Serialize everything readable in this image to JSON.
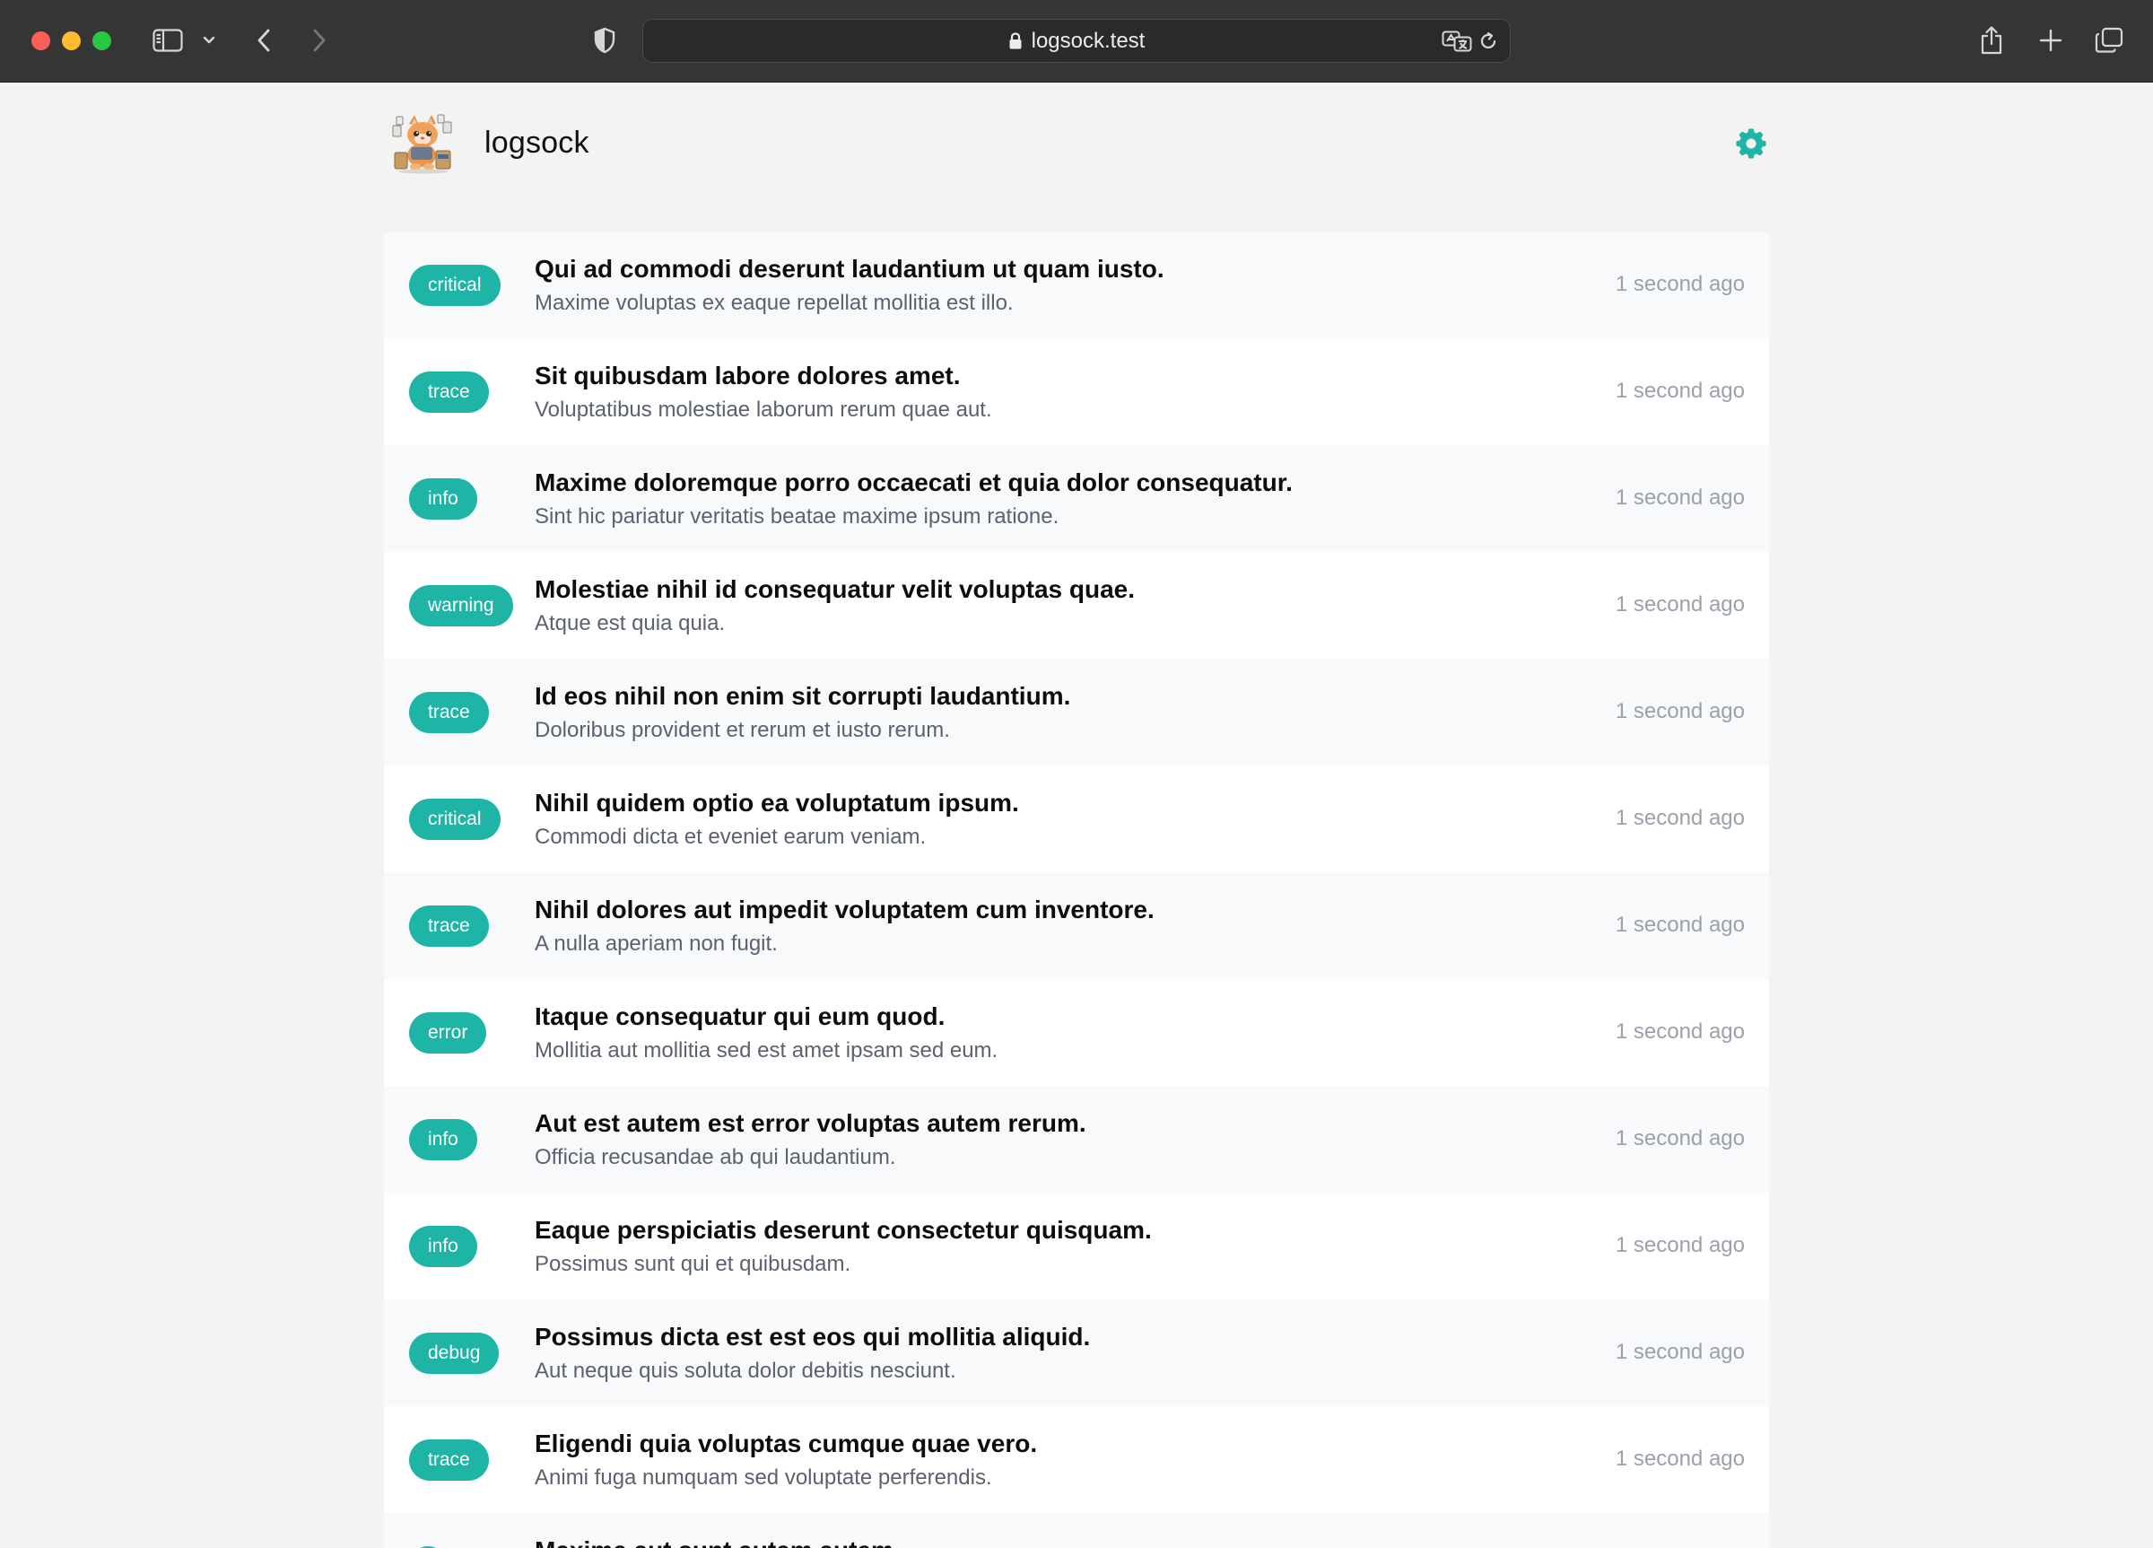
{
  "browser": {
    "url": "logsock.test",
    "icons": {
      "sidebar": "sidebar-toggle-icon",
      "back": "chevron-left-icon",
      "forward": "chevron-right-icon",
      "privacy": "shield-icon",
      "lock": "lock-icon",
      "translate": "translate-icon",
      "reload": "reload-icon",
      "share": "share-icon",
      "new_tab": "plus-icon",
      "tabs": "tabs-overview-icon"
    }
  },
  "app": {
    "name": "logsock",
    "accent_color": "#1fb5a6",
    "settings_icon": "gear-icon"
  },
  "logs": [
    {
      "level": "critical",
      "title": "Qui ad commodi deserunt laudantium ut quam iusto.",
      "message": "Maxime voluptas ex eaque repellat mollitia est illo.",
      "time": "1 second ago"
    },
    {
      "level": "trace",
      "title": "Sit quibusdam labore dolores amet.",
      "message": "Voluptatibus molestiae laborum rerum quae aut.",
      "time": "1 second ago"
    },
    {
      "level": "info",
      "title": "Maxime doloremque porro occaecati et quia dolor consequatur.",
      "message": "Sint hic pariatur veritatis beatae maxime ipsum ratione.",
      "time": "1 second ago"
    },
    {
      "level": "warning",
      "title": "Molestiae nihil id consequatur velit voluptas quae.",
      "message": "Atque est quia quia.",
      "time": "1 second ago"
    },
    {
      "level": "trace",
      "title": "Id eos nihil non enim sit corrupti laudantium.",
      "message": "Doloribus provident et rerum et iusto rerum.",
      "time": "1 second ago"
    },
    {
      "level": "critical",
      "title": "Nihil quidem optio ea voluptatum ipsum.",
      "message": "Commodi dicta et eveniet earum veniam.",
      "time": "1 second ago"
    },
    {
      "level": "trace",
      "title": "Nihil dolores aut impedit voluptatem cum inventore.",
      "message": "A nulla aperiam non fugit.",
      "time": "1 second ago"
    },
    {
      "level": "error",
      "title": "Itaque consequatur qui eum quod.",
      "message": "Mollitia aut mollitia sed est amet ipsam sed eum.",
      "time": "1 second ago"
    },
    {
      "level": "info",
      "title": "Aut est autem est error voluptas autem rerum.",
      "message": "Officia recusandae ab qui laudantium.",
      "time": "1 second ago"
    },
    {
      "level": "info",
      "title": "Eaque perspiciatis deserunt consectetur quisquam.",
      "message": "Possimus sunt qui et quibusdam.",
      "time": "1 second ago"
    },
    {
      "level": "debug",
      "title": "Possimus dicta est est eos qui mollitia aliquid.",
      "message": "Aut neque quis soluta dolor debitis nesciunt.",
      "time": "1 second ago"
    },
    {
      "level": "trace",
      "title": "Eligendi quia voluptas cumque quae vero.",
      "message": "Animi fuga numquam sed voluptate perferendis.",
      "time": "1 second ago"
    },
    {
      "level": "",
      "title": "Maxime aut sunt autem autem.",
      "message": "",
      "time": ""
    }
  ]
}
